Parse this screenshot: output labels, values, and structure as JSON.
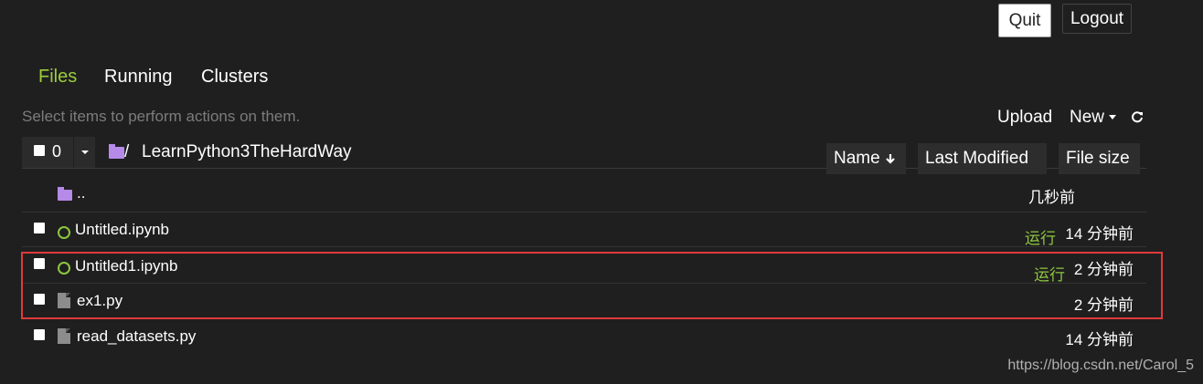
{
  "header": {
    "quit_label": "Quit",
    "logout_label": "Logout"
  },
  "tabs": [
    {
      "label": "Files",
      "active": true
    },
    {
      "label": "Running",
      "active": false
    },
    {
      "label": "Clusters",
      "active": false
    }
  ],
  "toolbar": {
    "hint": "Select items to perform actions on them.",
    "upload_label": "Upload",
    "new_label": "New",
    "refresh_icon": "refresh-icon"
  },
  "selection": {
    "count": "0"
  },
  "breadcrumb": {
    "root": "/",
    "folder": "LearnPython3TheHardWay"
  },
  "sort": {
    "name_label": "Name",
    "modified_label": "Last Modified",
    "size_label": "File size"
  },
  "items": [
    {
      "name": "..",
      "type": "folder",
      "time": "几秒前",
      "running": ""
    },
    {
      "name": "Untitled.ipynb",
      "type": "notebook",
      "time": "14 分钟前",
      "running": "运行"
    },
    {
      "name": "Untitled1.ipynb",
      "type": "notebook",
      "time": "2 分钟前",
      "running": "运行"
    },
    {
      "name": "ex1.py",
      "type": "file",
      "time": "2 分钟前",
      "running": ""
    },
    {
      "name": "read_datasets.py",
      "type": "file",
      "time": "14 分钟前",
      "running": ""
    }
  ],
  "colors": {
    "accent": "#9ccc3c",
    "running": "#8dc63f",
    "highlight": "#e03a3a",
    "folder": "#b58ae8"
  },
  "watermark": "https://blog.csdn.net/Carol_5"
}
